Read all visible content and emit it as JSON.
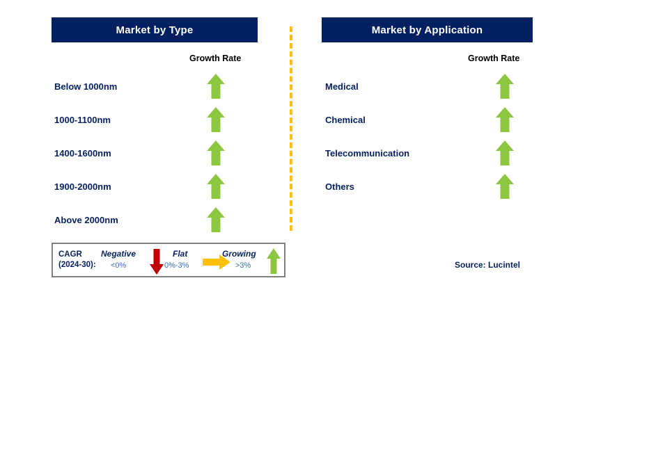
{
  "chart_data": {
    "type": "table",
    "title": "Market Segmentation Growth Rate Outlook",
    "legend_position": "bottom-left",
    "panels": [
      {
        "title": "Market by Type",
        "column_header": "Growth Rate",
        "categories": [
          "Below 1000nm",
          "1000-1100nm",
          "1400-1600nm",
          "1900-2000nm",
          "Above 2000nm"
        ],
        "values": [
          "growing",
          "growing",
          "growing",
          "growing",
          "growing"
        ],
        "icons": [
          "arrow-up-green",
          "arrow-up-green",
          "arrow-up-green",
          "arrow-up-green",
          "arrow-up-green"
        ]
      },
      {
        "title": "Market by Application",
        "column_header": "Growth Rate",
        "categories": [
          "Medical",
          "Chemical",
          "Telecommunication",
          "Others"
        ],
        "values": [
          "growing",
          "growing",
          "growing",
          "growing"
        ],
        "icons": [
          "arrow-up-green",
          "arrow-up-green",
          "arrow-up-green",
          "arrow-up-green"
        ]
      }
    ],
    "legend": {
      "label_line1": "CAGR",
      "label_line2": "(2024-30):",
      "entries": [
        {
          "title": "Negative",
          "value": "<0%",
          "icon": "arrow-down-red",
          "color": "#C00000"
        },
        {
          "title": "Flat",
          "value": "0%-3%",
          "icon": "arrow-right-orange",
          "color": "#FFC000"
        },
        {
          "title": "Growing",
          "value": ">3%",
          "icon": "arrow-up-green",
          "color": "#8DC63F"
        }
      ]
    },
    "source": "Source: Lucintel"
  },
  "panel_type": {
    "title": "Market by Type",
    "growth_header": "Growth Rate",
    "rows": [
      {
        "label": "Below 1000nm"
      },
      {
        "label": "1000-1100nm"
      },
      {
        "label": "1400-1600nm"
      },
      {
        "label": "1900-2000nm"
      },
      {
        "label": "Above 2000nm"
      }
    ]
  },
  "panel_application": {
    "title": "Market by Application",
    "growth_header": "Growth Rate",
    "rows": [
      {
        "label": "Medical"
      },
      {
        "label": "Chemical"
      },
      {
        "label": "Telecommunication"
      },
      {
        "label": "Others"
      }
    ]
  },
  "legend": {
    "cagr_line1": "CAGR",
    "cagr_line2": "(2024-30):",
    "negative_title": "Negative",
    "negative_value": "<0%",
    "flat_title": "Flat",
    "flat_value": "0%-3%",
    "growing_title": "Growing",
    "growing_value": ">3%"
  },
  "source": {
    "text": "Source: Lucintel"
  },
  "colors": {
    "header_navy": "#022060",
    "label_navy": "#06215e",
    "green": "#8DC63F",
    "red": "#C00000",
    "orange": "#FFC000",
    "divider_orange": "#FFC000",
    "legend_border": "#808080",
    "legend_value_blue": "#3d6fb5"
  }
}
